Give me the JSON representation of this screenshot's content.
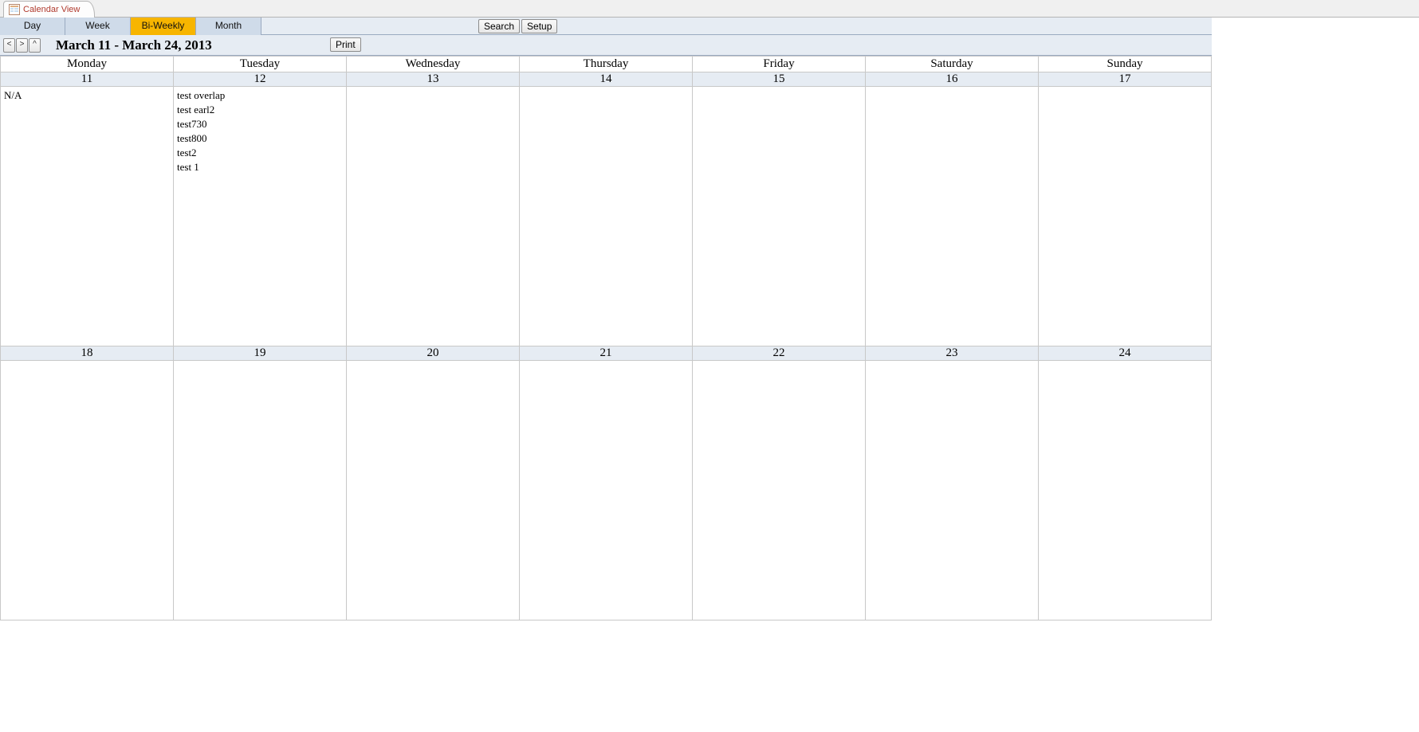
{
  "doc_tab": {
    "title": "Calendar View"
  },
  "view_tabs": [
    {
      "label": "Day",
      "active": false
    },
    {
      "label": "Week",
      "active": false
    },
    {
      "label": "Bi-Weekly",
      "active": true
    },
    {
      "label": "Month",
      "active": false
    }
  ],
  "toolbar": {
    "search_label": "Search",
    "setup_label": "Setup",
    "print_label": "Print"
  },
  "nav": {
    "prev_glyph": "<",
    "next_glyph": ">",
    "today_glyph": "^",
    "range_title": "March 11 - March 24, 2013"
  },
  "day_headers": [
    "Monday",
    "Tuesday",
    "Wednesday",
    "Thursday",
    "Friday",
    "Saturday",
    "Sunday"
  ],
  "weeks": [
    {
      "dates": [
        "11",
        "12",
        "13",
        "14",
        "15",
        "16",
        "17"
      ],
      "cells": [
        [
          "N/A"
        ],
        [
          "test overlap",
          "test earl2",
          "test730",
          "test800",
          "test2",
          "test 1"
        ],
        [],
        [],
        [],
        [],
        []
      ]
    },
    {
      "dates": [
        "18",
        "19",
        "20",
        "21",
        "22",
        "23",
        "24"
      ],
      "cells": [
        [],
        [],
        [],
        [],
        [],
        [],
        []
      ]
    }
  ]
}
